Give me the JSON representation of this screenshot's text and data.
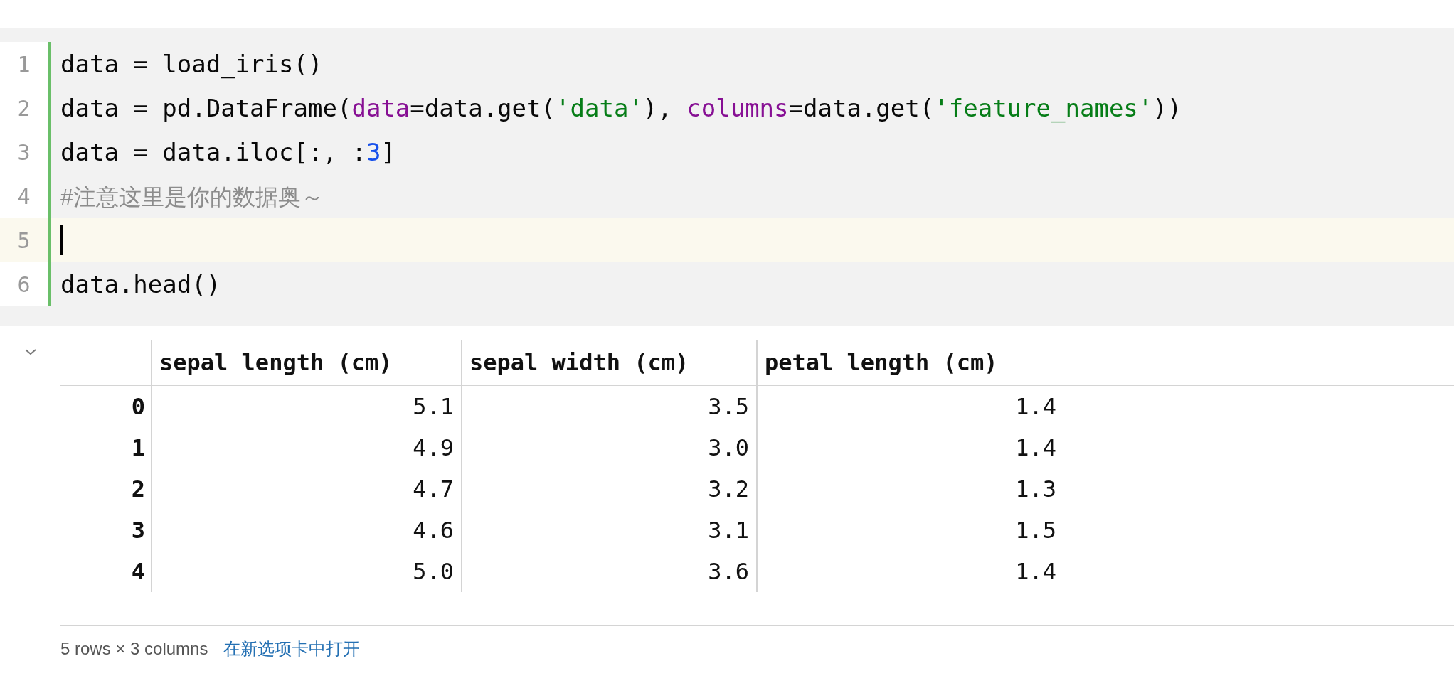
{
  "code_cell": {
    "lines": [
      {
        "number": "1",
        "current": false,
        "tokens": [
          {
            "text": "data = load_iris()",
            "kind": "plain"
          }
        ]
      },
      {
        "number": "2",
        "current": false,
        "tokens": [
          {
            "text": "data = pd.DataFrame(",
            "kind": "plain"
          },
          {
            "text": "data",
            "kind": "param"
          },
          {
            "text": "=data.get(",
            "kind": "plain"
          },
          {
            "text": "'data'",
            "kind": "string"
          },
          {
            "text": "), ",
            "kind": "plain"
          },
          {
            "text": "columns",
            "kind": "param"
          },
          {
            "text": "=data.get(",
            "kind": "plain"
          },
          {
            "text": "'feature_names'",
            "kind": "string"
          },
          {
            "text": "))",
            "kind": "plain"
          }
        ]
      },
      {
        "number": "3",
        "current": false,
        "tokens": [
          {
            "text": "data = data.iloc[:, :",
            "kind": "plain"
          },
          {
            "text": "3",
            "kind": "number"
          },
          {
            "text": "]",
            "kind": "plain"
          }
        ]
      },
      {
        "number": "4",
        "current": false,
        "tokens": [
          {
            "text": "#注意这里是你的数据奥～",
            "kind": "comment"
          }
        ]
      },
      {
        "number": "5",
        "current": true
      },
      {
        "number": "6",
        "current": false,
        "tokens": [
          {
            "text": "data.head()",
            "kind": "plain"
          }
        ]
      }
    ]
  },
  "output": {
    "expanded": true,
    "table": {
      "columns": [
        "sepal length (cm)",
        "sepal width (cm)",
        "petal length (cm)"
      ],
      "rows": [
        {
          "index": "0",
          "values": [
            "5.1",
            "3.5",
            "1.4"
          ]
        },
        {
          "index": "1",
          "values": [
            "4.9",
            "3.0",
            "1.4"
          ]
        },
        {
          "index": "2",
          "values": [
            "4.7",
            "3.2",
            "1.3"
          ]
        },
        {
          "index": "3",
          "values": [
            "4.6",
            "3.1",
            "1.5"
          ]
        },
        {
          "index": "4",
          "values": [
            "5.0",
            "3.6",
            "1.4"
          ]
        }
      ]
    },
    "summary": "5 rows × 3 columns",
    "open_link": "在新选项卡中打开"
  }
}
